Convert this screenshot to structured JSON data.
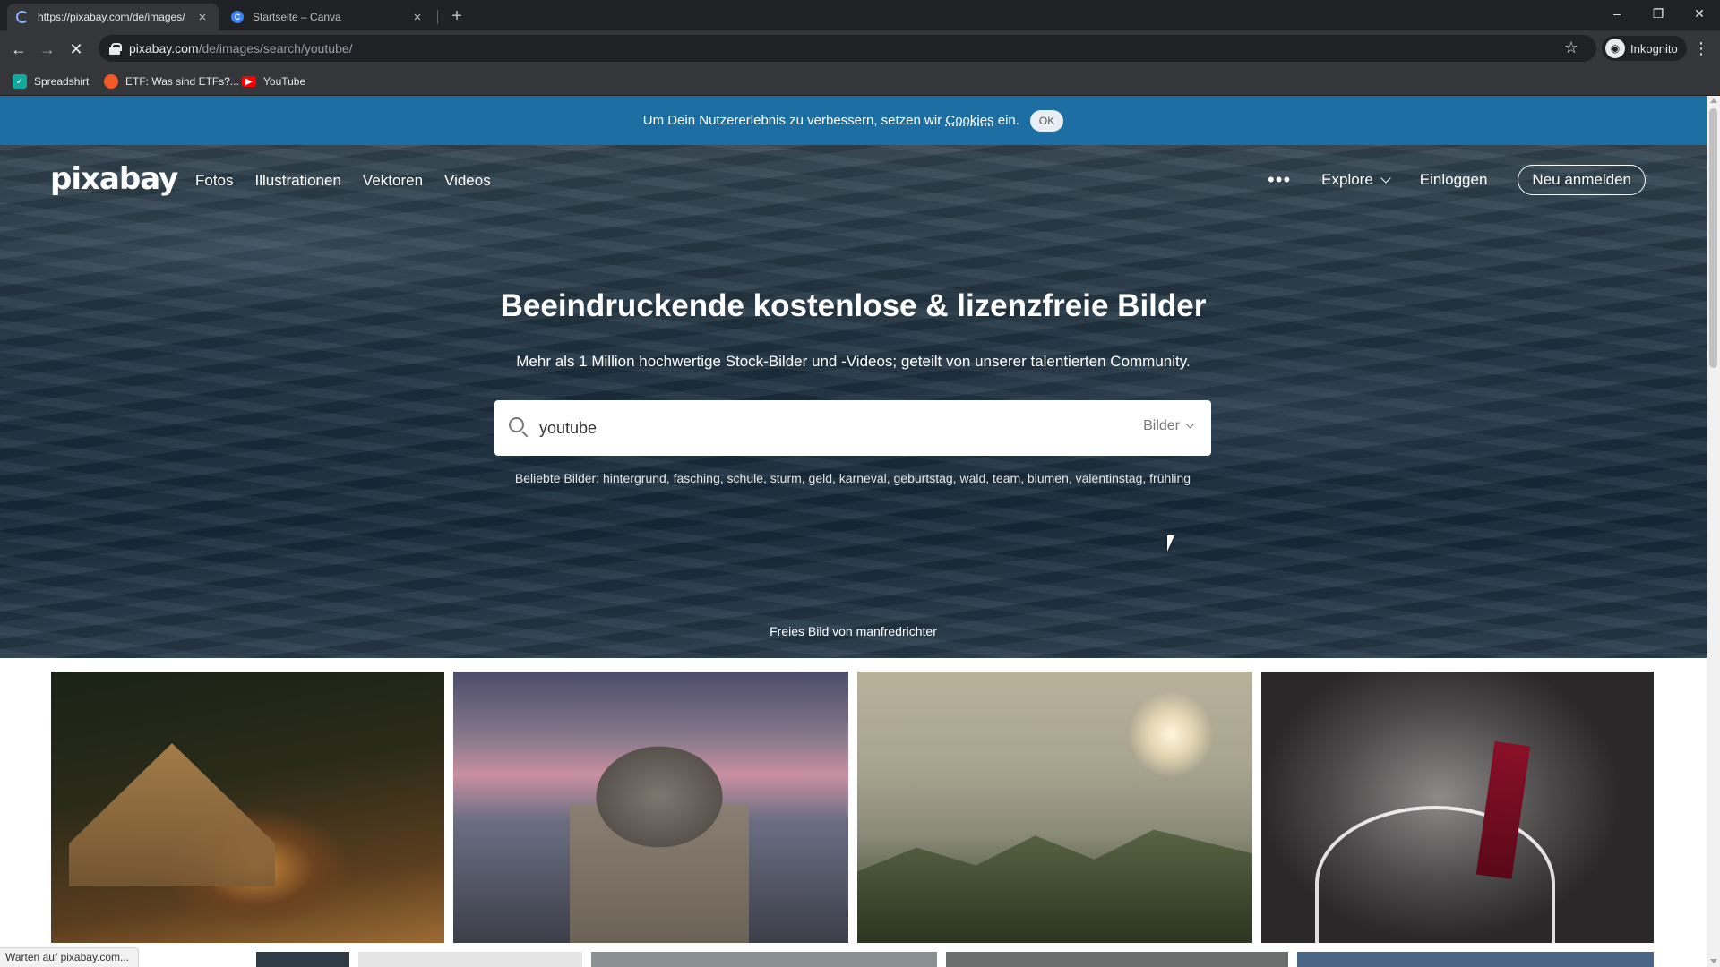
{
  "browser": {
    "tabs": [
      {
        "title": "https://pixabay.com/de/images/",
        "active": true
      },
      {
        "title": "Startseite – Canva",
        "active": false,
        "favicon": "C"
      }
    ],
    "new_tab": "+",
    "window": {
      "minimize": "–",
      "restore": "❐",
      "close": "✕"
    },
    "url_host": "pixabay.com",
    "url_path": "/de/images/search/youtube/",
    "profile": "Inkognito",
    "bookmarks": [
      {
        "label": "Spreadshirt",
        "color": "#13a89e"
      },
      {
        "label": "ETF: Was sind ETFs?...",
        "color": "#f15a24"
      },
      {
        "label": "YouTube",
        "color": "#ff0000"
      }
    ]
  },
  "cookie": {
    "text_before": "Um Dein Nutzererlebnis zu verbessern, setzen wir ",
    "link": "Cookies",
    "text_after": " ein.",
    "ok": "OK"
  },
  "header": {
    "logo": "pixabay",
    "nav": [
      "Fotos",
      "Illustrationen",
      "Vektoren",
      "Videos"
    ],
    "more": "•••",
    "explore": "Explore",
    "login": "Einloggen",
    "signup": "Neu anmelden"
  },
  "hero": {
    "title": "Beeindruckende kostenlose & lizenzfreie Bilder",
    "subtitle": "Mehr als 1 Million hochwertige Stock-Bilder und -Videos; geteilt von unserer talentierten Community.",
    "search_value": "youtube",
    "search_type": "Bilder",
    "popular_label": "Beliebte Bilder:",
    "popular_tags": [
      "hintergrund",
      "fasching",
      "schule",
      "sturm",
      "geld",
      "karneval",
      "geburtstag",
      "wald",
      "team",
      "blumen",
      "valentinstag",
      "frühling"
    ],
    "credit": "Freies Bild von manfredrichter"
  },
  "status_bar": "Warten auf pixabay.com...",
  "colors": {
    "cookie_bar": "#1d6fa3",
    "chrome_dark": "#202124",
    "chrome_toolbar": "#35363a"
  }
}
